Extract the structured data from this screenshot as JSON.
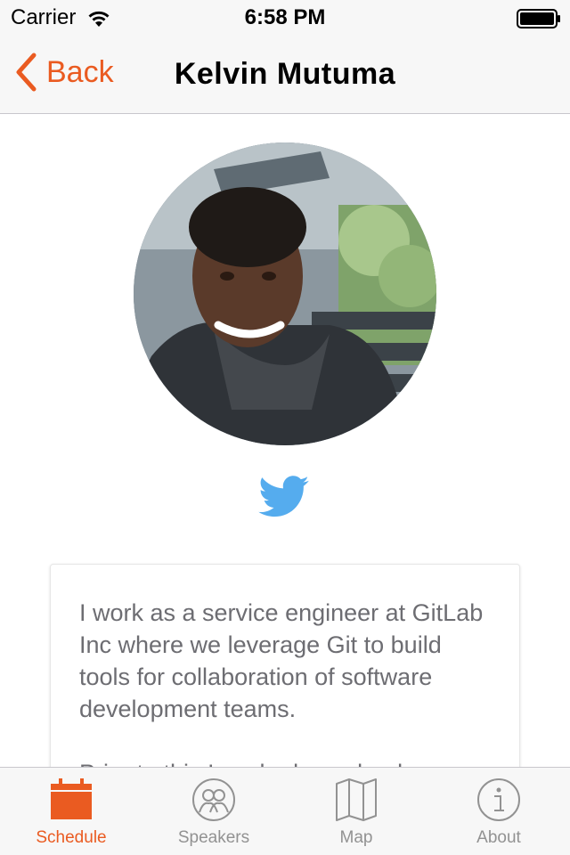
{
  "status_bar": {
    "carrier": "Carrier",
    "time": "6:58 PM",
    "wifi_icon": "wifi-icon",
    "battery_icon": "battery-icon"
  },
  "nav": {
    "back_label": "Back",
    "title": "Kelvin Mutuma",
    "back_icon": "chevron-left-icon"
  },
  "profile": {
    "avatar_icon": "speaker-photo",
    "twitter_icon": "twitter-icon"
  },
  "bio": {
    "paragraphs": [
      "I work as a service engineer at GitLab Inc where we leverage Git to build tools for collaboration of software development teams.",
      "Prior to this I worked as a lead"
    ]
  },
  "tabs": [
    {
      "label": "Schedule",
      "icon": "calendar-icon",
      "active": true
    },
    {
      "label": "Speakers",
      "icon": "speakers-icon",
      "active": false
    },
    {
      "label": "Map",
      "icon": "map-icon",
      "active": false
    },
    {
      "label": "About",
      "icon": "info-icon",
      "active": false
    }
  ],
  "colors": {
    "accent": "#ea5b21",
    "twitter": "#55acee",
    "tab_inactive": "#929292",
    "bar_background": "#f7f7f7"
  }
}
